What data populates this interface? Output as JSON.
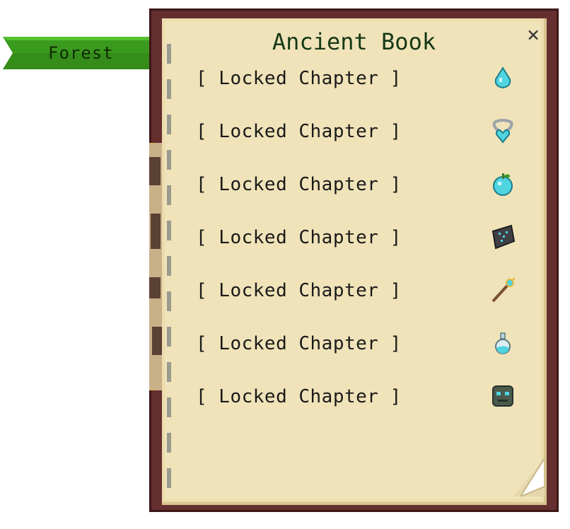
{
  "tab": {
    "label": "Forest"
  },
  "book": {
    "title": "Ancient Book",
    "close_symbol": "×",
    "chapters": [
      {
        "label": "[ Locked Chapter ]",
        "icon": "water-drop-icon"
      },
      {
        "label": "[ Locked Chapter ]",
        "icon": "heart-necklace-icon"
      },
      {
        "label": "[ Locked Chapter ]",
        "icon": "magic-fruit-icon"
      },
      {
        "label": "[ Locked Chapter ]",
        "icon": "rune-stone-icon"
      },
      {
        "label": "[ Locked Chapter ]",
        "icon": "wand-icon"
      },
      {
        "label": "[ Locked Chapter ]",
        "icon": "potion-bottle-icon"
      },
      {
        "label": "[ Locked Chapter ]",
        "icon": "stone-mask-icon"
      }
    ]
  },
  "colors": {
    "frame": "#652f2f",
    "page": "#f0e3b9",
    "title": "#153816",
    "tab_green": "#3a9a1e",
    "icon_cyan": "#4fd4e0"
  }
}
